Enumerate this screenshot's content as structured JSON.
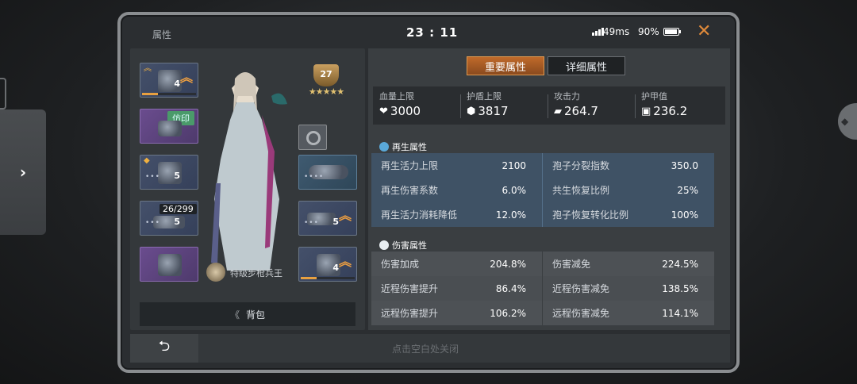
{
  "window": {
    "title": "属性",
    "clock": "23 : 11",
    "ping": "49ms",
    "battery": "90%",
    "close_glyph": "✕"
  },
  "side": {
    "expand_glyph": "›"
  },
  "character": {
    "level": "27",
    "stars": "★★★★★",
    "rank_label": "特级步枪兵王"
  },
  "equipment": {
    "slot1_count": "4",
    "slot2_tag": "仿印",
    "slot3_count": "5",
    "slot4_ammo": "26/299",
    "slot4_count": "5",
    "slot6_count": "5",
    "slot7_count": "4"
  },
  "backpack": {
    "arrow": "《",
    "label": "背包"
  },
  "tabs": {
    "primary": "重要属性",
    "detail": "详细属性"
  },
  "top_stats": [
    {
      "label": "血量上限",
      "icon": "heart-icon",
      "value": "3000"
    },
    {
      "label": "护盾上限",
      "icon": "shield-icon",
      "value": "3817"
    },
    {
      "label": "攻击力",
      "icon": "gun-icon",
      "value": "264.7"
    },
    {
      "label": "护甲值",
      "icon": "armor-icon",
      "value": "236.2"
    }
  ],
  "regen": {
    "title": "再生属性",
    "rows": [
      {
        "l_label": "再生活力上限",
        "l_value": "2100",
        "r_label": "孢子分裂指数",
        "r_value": "350.0"
      },
      {
        "l_label": "再生伤害系数",
        "l_value": "6.0%",
        "r_label": "共生恢复比例",
        "r_value": "25%"
      },
      {
        "l_label": "再生活力消耗降低",
        "l_value": "12.0%",
        "r_label": "孢子恢复转化比例",
        "r_value": "100%"
      }
    ]
  },
  "damage": {
    "title": "伤害属性",
    "rows": [
      {
        "l_label": "伤害加成",
        "l_value": "204.8%",
        "r_label": "伤害减免",
        "r_value": "224.5%"
      },
      {
        "l_label": "近程伤害提升",
        "l_value": "86.4%",
        "r_label": "近程伤害减免",
        "r_value": "138.5%"
      },
      {
        "l_label": "远程伤害提升",
        "l_value": "106.2%",
        "r_label": "远程伤害减免",
        "r_value": "114.1%"
      }
    ]
  },
  "footer": {
    "back_glyph": "⮌",
    "hint": "点击空白处关闭"
  },
  "colors": {
    "accent": "#e08a3a",
    "tab_active": "#c06a2a",
    "regen_row": "#3f5265"
  }
}
